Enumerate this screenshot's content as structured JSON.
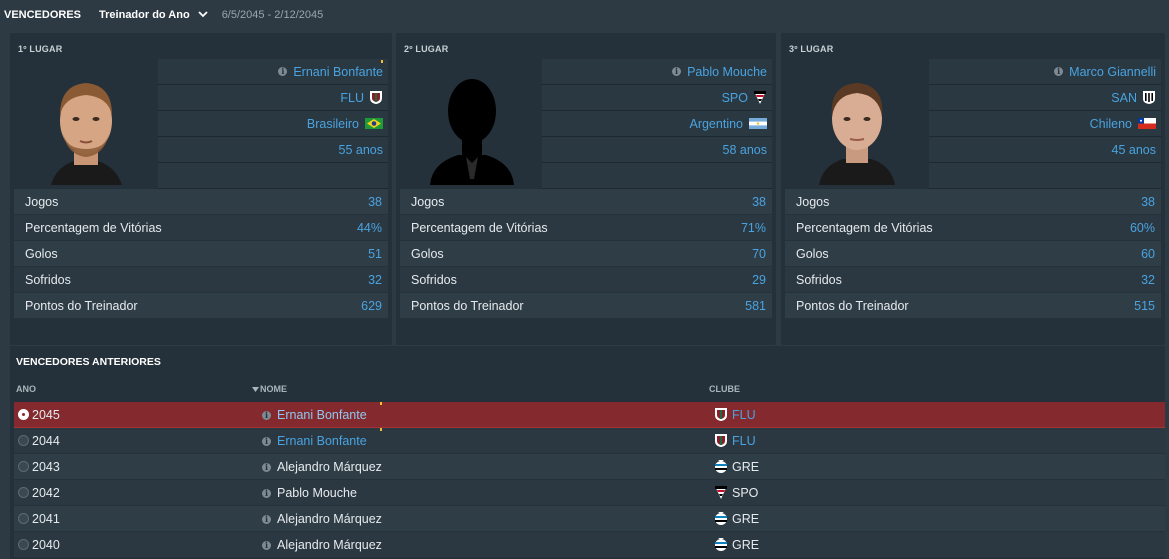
{
  "header": {
    "title": "VENCEDORES",
    "award": "Treinador do Ano",
    "dates": "6/5/2045 - 2/12/2045"
  },
  "podium": [
    {
      "place": "1º LUGAR",
      "name": "Ernani Bonfante",
      "club": "FLU",
      "nationality": "Brasileiro",
      "age": "55 anos",
      "stats": [
        {
          "label": "Jogos",
          "value": "38"
        },
        {
          "label": "Percentagem de Vitórias",
          "value": "44%"
        },
        {
          "label": "Golos",
          "value": "51"
        },
        {
          "label": "Sofridos",
          "value": "32"
        },
        {
          "label": "Pontos do Treinador",
          "value": "629"
        }
      ]
    },
    {
      "place": "2º LUGAR",
      "name": "Pablo Mouche",
      "club": "SPO",
      "nationality": "Argentino",
      "age": "58 anos",
      "stats": [
        {
          "label": "Jogos",
          "value": "38"
        },
        {
          "label": "Percentagem de Vitórias",
          "value": "71%"
        },
        {
          "label": "Golos",
          "value": "70"
        },
        {
          "label": "Sofridos",
          "value": "29"
        },
        {
          "label": "Pontos do Treinador",
          "value": "581"
        }
      ]
    },
    {
      "place": "3º LUGAR",
      "name": "Marco Giannelli",
      "club": "SAN",
      "nationality": "Chileno",
      "age": "45 anos",
      "stats": [
        {
          "label": "Jogos",
          "value": "38"
        },
        {
          "label": "Percentagem de Vitórias",
          "value": "60%"
        },
        {
          "label": "Golos",
          "value": "60"
        },
        {
          "label": "Sofridos",
          "value": "32"
        },
        {
          "label": "Pontos do Treinador",
          "value": "515"
        }
      ]
    }
  ],
  "previous": {
    "title": "VENCEDORES ANTERIORES",
    "columns": {
      "year": "ANO",
      "name": "NOME",
      "club": "CLUBE"
    },
    "rows": [
      {
        "year": "2045",
        "name": "Ernani Bonfante",
        "club": "FLU"
      },
      {
        "year": "2044",
        "name": "Ernani Bonfante",
        "club": "FLU"
      },
      {
        "year": "2043",
        "name": "Alejandro Márquez",
        "club": "GRE"
      },
      {
        "year": "2042",
        "name": "Pablo Mouche",
        "club": "SPO"
      },
      {
        "year": "2041",
        "name": "Alejandro Márquez",
        "club": "GRE"
      },
      {
        "year": "2040",
        "name": "Alejandro Márquez",
        "club": "GRE"
      }
    ]
  },
  "icons": {
    "info": "info-icon",
    "dropdown": "chevron-down-icon",
    "sort": "sort-down-icon"
  },
  "colors": {
    "link": "#4aa3e0",
    "selected_row": "#842a2e",
    "background": "#2d3a43",
    "panel": "#24313a"
  }
}
